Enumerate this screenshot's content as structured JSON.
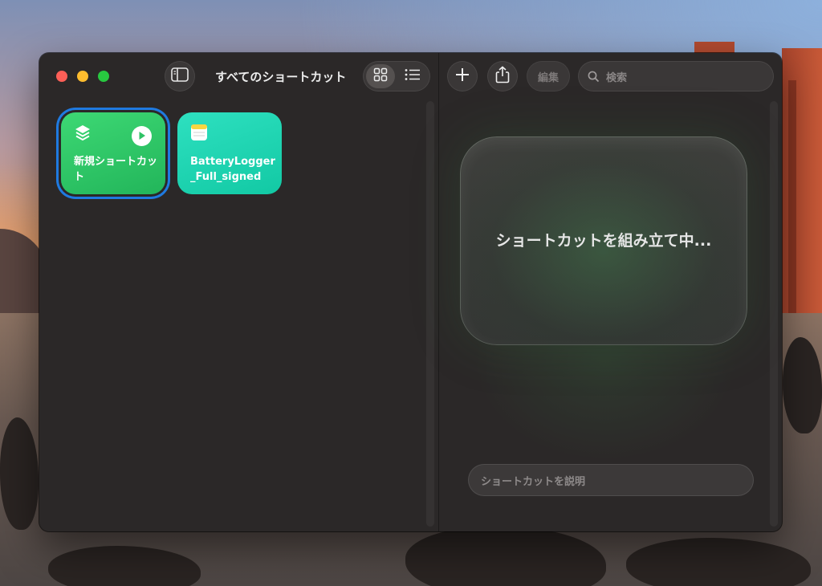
{
  "window": {
    "title": "すべてのショートカット"
  },
  "toolbar": {
    "sidebar_icon": "sidebar-icon",
    "grid_view_icon": "grid-icon",
    "list_view_icon": "list-icon",
    "add_icon": "plus-icon",
    "share_icon": "share-icon",
    "edit_label": "編集",
    "search_placeholder": "検索"
  },
  "shortcuts": [
    {
      "label": "新規ショートカット",
      "icon": "layers-icon",
      "color": "#34c759",
      "selected": true
    },
    {
      "label": "BatteryLogger_Full_signed",
      "icon": "notes-icon",
      "color": "#1fd6b3",
      "selected": false
    }
  ],
  "editor": {
    "status": "ショートカットを組み立て中...",
    "describe_placeholder": "ショートカットを説明"
  }
}
